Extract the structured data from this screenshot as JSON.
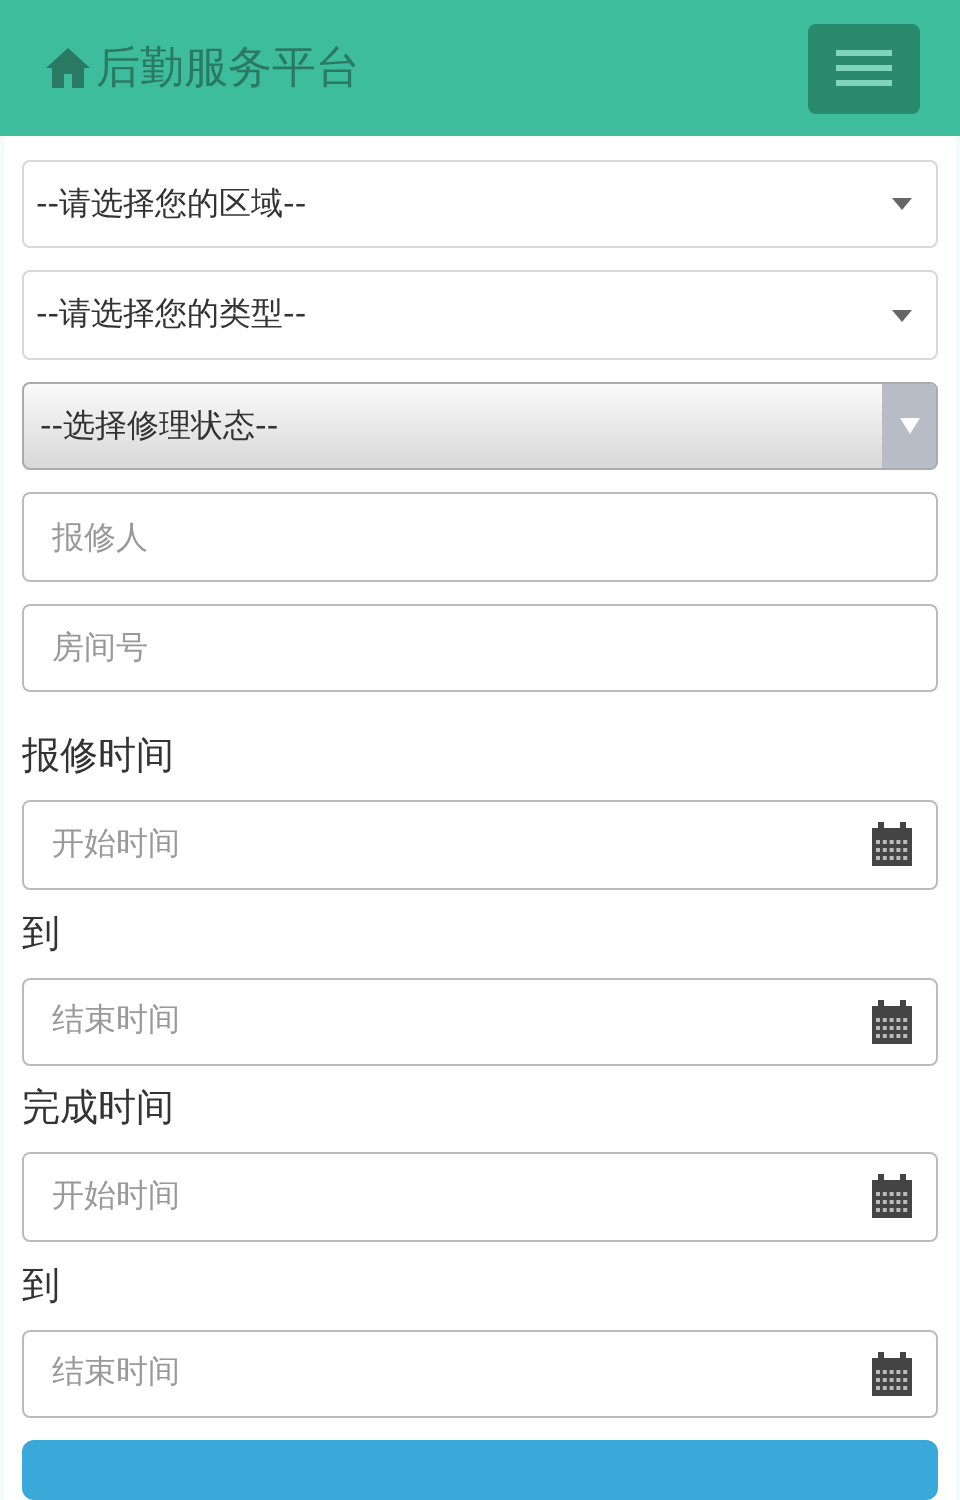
{
  "header": {
    "title": "后勤服务平台"
  },
  "filters": [
    {
      "kind": "select",
      "value": "--请选择您的区域--"
    },
    {
      "kind": "select",
      "value": "--请选择您的类型--"
    },
    {
      "kind": "native-select",
      "value": "--选择修理状态--"
    },
    {
      "kind": "input",
      "placeholder": "报修人"
    },
    {
      "kind": "input",
      "placeholder": "房间号"
    }
  ],
  "date_ranges": [
    {
      "label": "报修时间",
      "start": {
        "placeholder": "开始时间"
      },
      "separator": "到",
      "end": {
        "placeholder": "结束时间"
      }
    },
    {
      "label": "完成时间",
      "start": {
        "placeholder": "开始时间"
      },
      "separator": "到",
      "end": {
        "placeholder": "结束时间"
      }
    }
  ]
}
